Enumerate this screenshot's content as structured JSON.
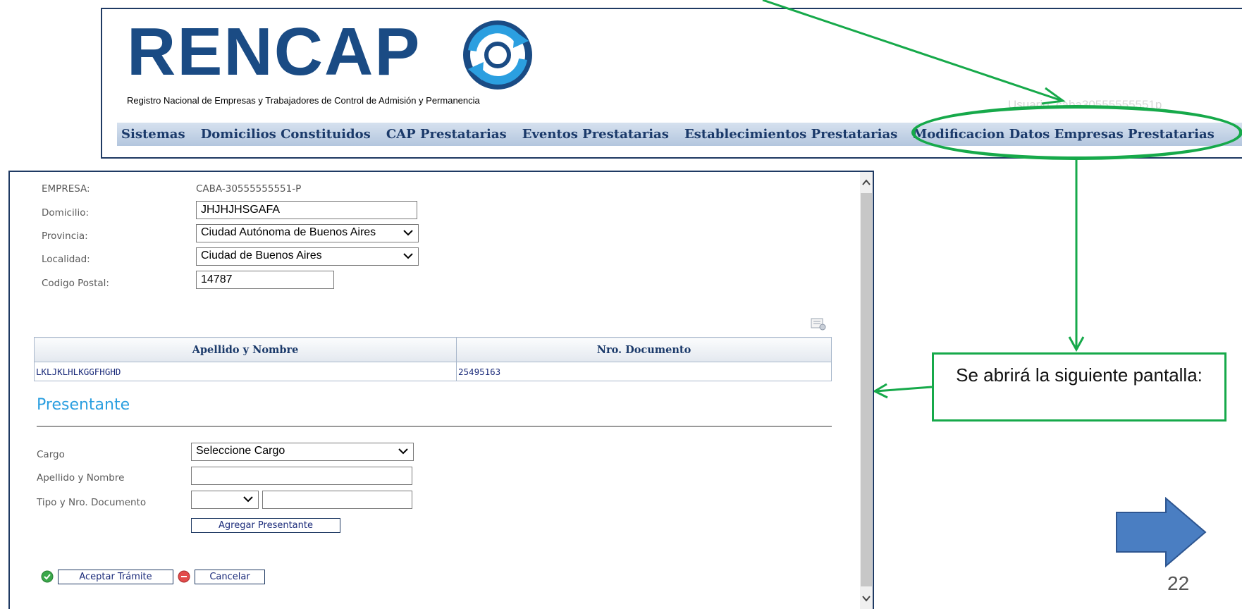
{
  "header": {
    "logo_text": "RENCAP",
    "logo_subtitle": "Registro Nacional de Empresas y Trabajadores de Control de Admisión y Permanencia",
    "user_label": "Usuario: caba30555555551p",
    "menu": [
      "Sistemas",
      "Domicilios Constituidos",
      "CAP Prestatarias",
      "Eventos Prestatarias",
      "Establecimientos Prestatarias",
      "Modificacion Datos Empresas Prestatarias"
    ],
    "brand_color": "#1a4b84",
    "menu_color": "#1b3a6a"
  },
  "form": {
    "empresa_label": "EMPRESA:",
    "empresa_value": "CABA-30555555551-P",
    "domicilio_label": "Domicilio:",
    "domicilio_value": "JHJHJHSGAFA",
    "provincia_label": "Provincia:",
    "provincia_value": "Ciudad Autónoma de Buenos Aires",
    "localidad_label": "Localidad:",
    "localidad_value": "Ciudad de Buenos Aires",
    "codigo_postal_label": "Codigo Postal:",
    "codigo_postal_value": "14787"
  },
  "table": {
    "columns": [
      "Apellido y Nombre",
      "Nro. Documento"
    ],
    "rows": [
      [
        "LKLJKLHLKGGFHGHD",
        "25495163"
      ]
    ]
  },
  "presentante": {
    "title": "Presentante",
    "cargo_label": "Cargo",
    "cargo_value": "Seleccione Cargo",
    "apellido_label": "Apellido y Nombre",
    "apellido_value": "",
    "tipo_doc_label": "Tipo y Nro. Documento",
    "tipo_doc_value": "",
    "nro_doc_value": "",
    "agregar_button": "Agregar Presentante",
    "accent_color": "#2b9fe0"
  },
  "actions": {
    "aceptar_button": "Aceptar Trámite",
    "cancelar_button": "Cancelar"
  },
  "annotations": {
    "callout_text": "Se abrirá la siguiente pantalla:",
    "page_number": "22",
    "highlight_color": "#16a94a",
    "next_arrow_color": "#4a7ec2"
  }
}
